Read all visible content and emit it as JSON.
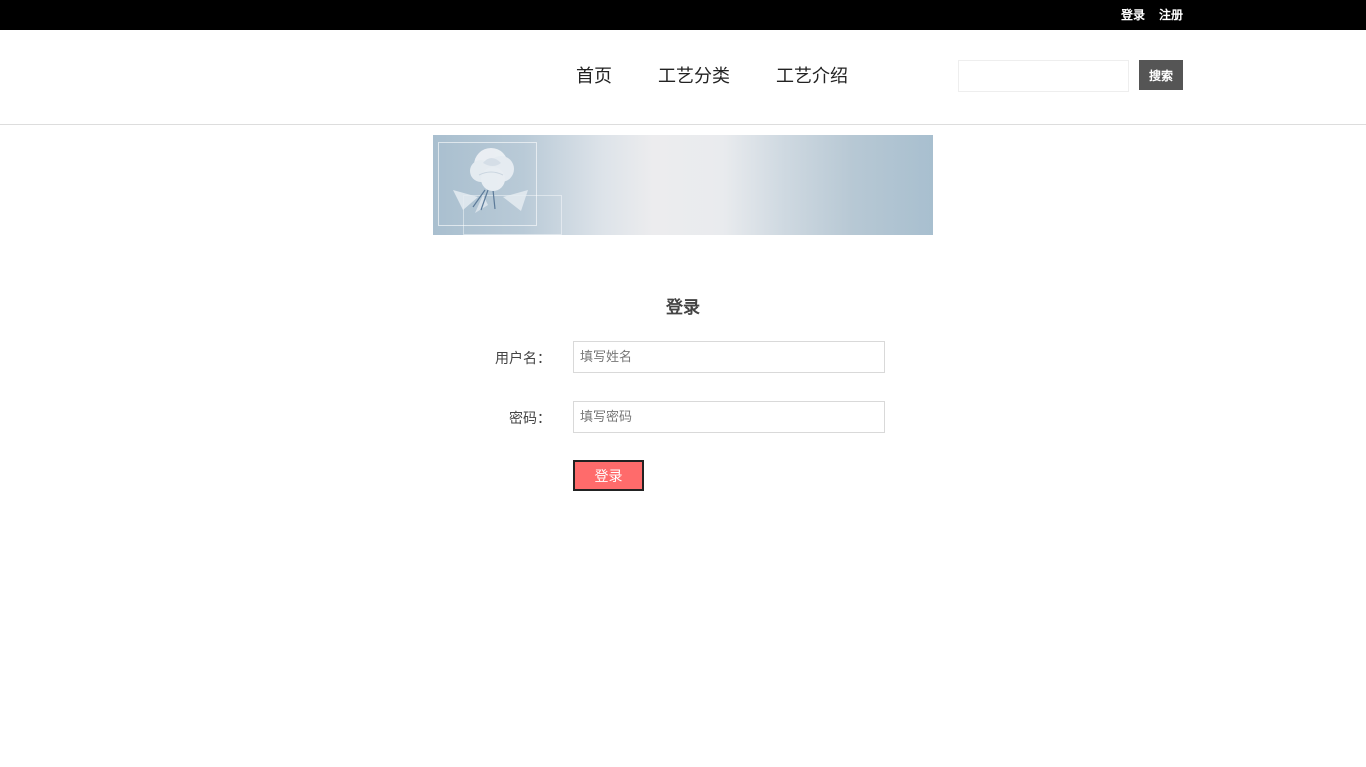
{
  "topbar": {
    "login_label": "登录",
    "register_label": "注册"
  },
  "nav": {
    "items": [
      {
        "label": "首页"
      },
      {
        "label": "工艺分类"
      },
      {
        "label": "工艺介绍"
      }
    ]
  },
  "search": {
    "value": "",
    "button_label": "搜索"
  },
  "banner": {
    "image": "flower-banner"
  },
  "login": {
    "title": "登录",
    "username_label": "用户名：",
    "username_placeholder": "填写姓名",
    "password_label": "密码：",
    "password_placeholder": "填写密码",
    "submit_label": "登录"
  },
  "colors": {
    "topbar_bg": "#000000",
    "search_button_bg": "#555555",
    "login_button_bg": "#ff6b6b"
  }
}
